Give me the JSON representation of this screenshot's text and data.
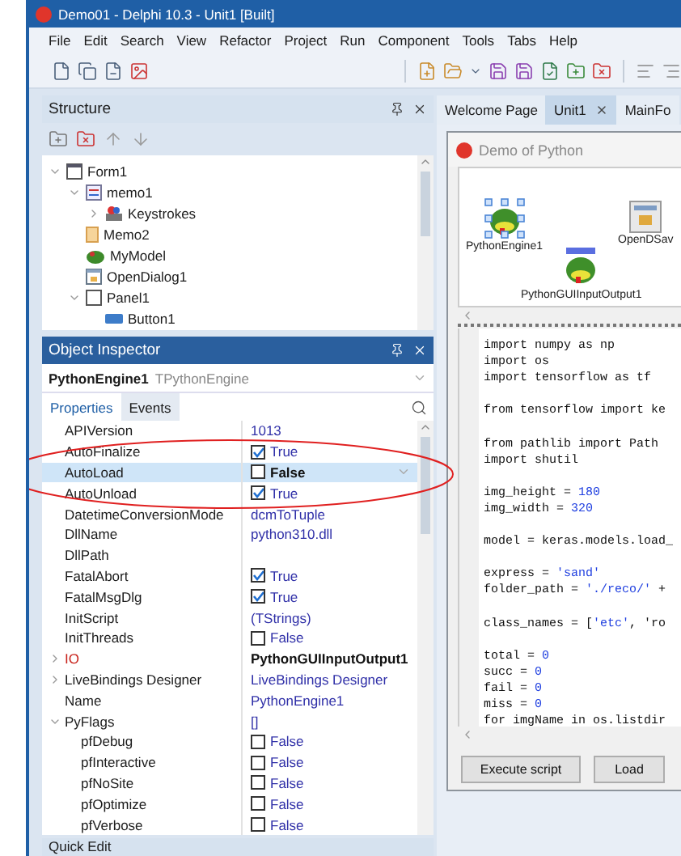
{
  "window": {
    "title": "Demo01 - Delphi 10.3 - Unit1 [Built]"
  },
  "menu": [
    "File",
    "Edit",
    "Search",
    "View",
    "Refactor",
    "Project",
    "Run",
    "Component",
    "Tools",
    "Tabs",
    "Help"
  ],
  "structure": {
    "title": "Structure",
    "tree": [
      {
        "label": "Form1",
        "kind": "form",
        "expanded": true,
        "children": [
          {
            "label": "memo1",
            "kind": "memo",
            "expanded": true,
            "children": [
              {
                "label": "Keystrokes",
                "kind": "keys",
                "expanded": false
              }
            ]
          },
          {
            "label": "Memo2",
            "kind": "memo2"
          },
          {
            "label": "MyModel",
            "kind": "model"
          },
          {
            "label": "OpenDialog1",
            "kind": "dialog"
          },
          {
            "label": "Panel1",
            "kind": "panel",
            "expanded": true,
            "children": [
              {
                "label": "Button1",
                "kind": "button"
              }
            ]
          }
        ]
      }
    ]
  },
  "object_inspector": {
    "title": "Object Inspector",
    "component": "PythonEngine1",
    "component_type": "TPythonEngine",
    "tabs": [
      {
        "label": "Properties",
        "selected": true
      },
      {
        "label": "Events",
        "selected": false
      }
    ],
    "properties": [
      {
        "name": "APIVersion",
        "kind": "text",
        "value": "1013",
        "selected": false
      },
      {
        "name": "AutoFinalize",
        "kind": "check",
        "value": "True",
        "checked": true,
        "selected": false
      },
      {
        "name": "AutoLoad",
        "kind": "check",
        "value": "False",
        "checked": false,
        "selected": true
      },
      {
        "name": "AutoUnload",
        "kind": "check",
        "value": "True",
        "checked": true,
        "selected": false
      },
      {
        "name": "DatetimeConversionMode",
        "kind": "text",
        "value": "dcmToTuple",
        "selected": false
      },
      {
        "name": "DllName",
        "kind": "text",
        "value": "python310.dll",
        "selected": false
      },
      {
        "name": "DllPath",
        "kind": "text",
        "selected": false
      },
      {
        "name": "FatalAbort",
        "kind": "check",
        "value": "True",
        "checked": true,
        "selected": false
      },
      {
        "name": "FatalMsgDlg",
        "kind": "check",
        "value": "True",
        "checked": true,
        "selected": false
      },
      {
        "name": "InitScript",
        "kind": "text",
        "value": "(TStrings)",
        "selected": false
      },
      {
        "name": "InitThreads",
        "kind": "check",
        "value": "False",
        "checked": false,
        "selected": false
      },
      {
        "name": "IO",
        "kind": "reference",
        "value": "PythonGUIInputOutput1",
        "expanded": false,
        "selected": false
      },
      {
        "name": "LiveBindings Designer",
        "kind": "text",
        "value": "LiveBindings Designer",
        "expanded": false,
        "selected": false
      },
      {
        "name": "Name",
        "kind": "text",
        "value": "PythonEngine1",
        "selected": false
      },
      {
        "name": "PyFlags",
        "kind": "text",
        "value": "[]",
        "expanded": true,
        "selected": false,
        "children": [
          {
            "name": "pfDebug",
            "kind": "check",
            "value": "False",
            "checked": false,
            "selected": false
          },
          {
            "name": "pfInteractive",
            "kind": "check",
            "value": "False",
            "checked": false,
            "selected": false
          },
          {
            "name": "pfNoSite",
            "kind": "check",
            "value": "False",
            "checked": false,
            "selected": false
          },
          {
            "name": "pfOptimize",
            "kind": "check",
            "value": "False",
            "checked": false,
            "selected": false
          },
          {
            "name": "pfVerbose",
            "kind": "check",
            "value": "False",
            "checked": false,
            "selected": false
          }
        ]
      }
    ]
  },
  "quick_edit": {
    "title": "Quick Edit"
  },
  "editor": {
    "tabs": [
      {
        "label": "Welcome Page",
        "selected": false
      },
      {
        "label": "Unit1",
        "selected": true
      },
      {
        "label": "MainFo",
        "selected": false
      }
    ],
    "form": {
      "title": "Demo of Python",
      "components": [
        {
          "label": "PythonEngine1",
          "kind": "python",
          "selected": true
        },
        {
          "label": "OpenDSav",
          "kind": "dialog",
          "selected": false
        },
        {
          "label": "PythonGUIInputOutput1",
          "kind": "python-io",
          "selected": false
        }
      ],
      "code_blocks": [
        [
          "import numpy as np",
          "import os",
          "import tensorflow as tf"
        ],
        [
          "from tensorflow import ke"
        ],
        [
          "from pathlib import Path",
          "import shutil"
        ],
        [
          "img_height = 180",
          "img_width = 320"
        ],
        [
          "model = keras.models.load_"
        ],
        [
          "express = 'sand'",
          "folder_path = './reco/' +"
        ],
        [
          "class_names = ['etc', 'ro"
        ],
        [
          "total = 0",
          "succ = 0",
          "fail = 0",
          "miss = 0",
          "for imgName in os.listdir"
        ]
      ],
      "buttons": [
        "Execute script",
        "Load"
      ]
    }
  }
}
